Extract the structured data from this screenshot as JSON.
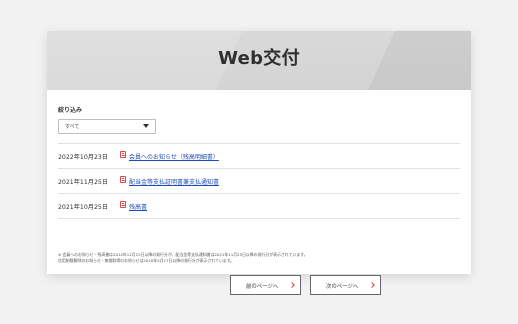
{
  "header": {
    "title": "Web交付"
  },
  "filter": {
    "label": "絞り込み",
    "selected": "すべて"
  },
  "documents": [
    {
      "date": "2022年10月23日",
      "label": "会員へのお知らせ（残高明細書）",
      "icon": "pdf-document-icon"
    },
    {
      "date": "2021年11月25日",
      "label": "配当金等支払証明書兼支払通知書",
      "icon": "pdf-document-icon"
    },
    {
      "date": "2021年10月25日",
      "label": "残高書",
      "icon": "pdf-document-icon"
    }
  ],
  "notes": [
    "※ 会員へのお知らせ・残高書は2014年12月15日以降の発行分が、配当金等支払通知書は2021年11月25日以降の発行分が表示されています。",
    "信用制限解除のお知らせ・無償取得のお知らせは2020年2月17日以降の発行分が表示されています。"
  ],
  "pagination": {
    "prev_label": "前のページへ",
    "next_label": "次のページへ"
  },
  "colors": {
    "link": "#1f4db8",
    "pdf_icon": "#d94a4a"
  }
}
